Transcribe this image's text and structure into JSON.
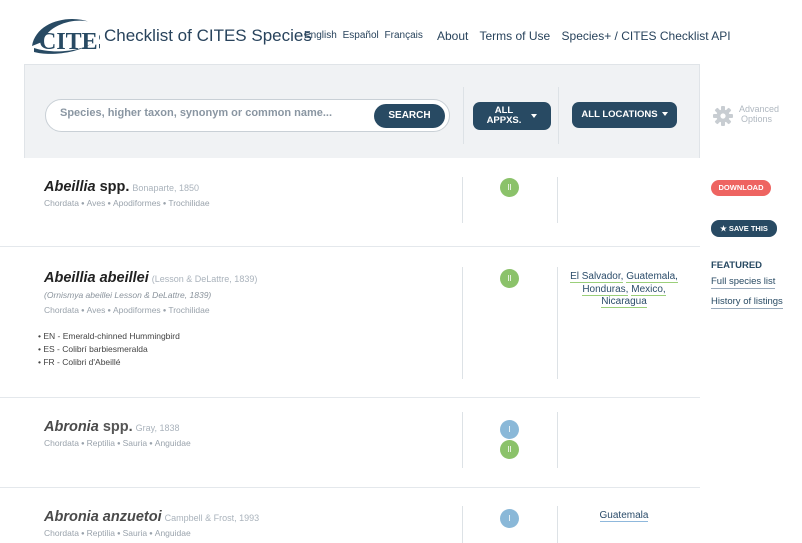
{
  "header": {
    "logo_text": "CITES",
    "title": "Checklist of CITES Species",
    "languages": [
      "English",
      "Español",
      "Français"
    ],
    "nav": [
      "About",
      "Terms of Use",
      "Species+ / CITES Checklist API"
    ]
  },
  "search": {
    "placeholder": "Species, higher taxon, synonym or common name...",
    "button": "SEARCH",
    "appendix_filter_line1": "ALL",
    "appendix_filter_line2": "APPXS.",
    "location_filter": "ALL LOCATIONS",
    "advanced_line1": "Advanced",
    "advanced_line2": "Options"
  },
  "results": [
    {
      "genus_or_name": "Abeillia",
      "suffix": "spp.",
      "author": "Bonaparte, 1850",
      "synonym": "",
      "taxonomy": [
        "Chordata",
        "Aves",
        "Apodiformes",
        "Trochilidae"
      ],
      "common_names": [],
      "appendices": [
        "II"
      ],
      "locations": []
    },
    {
      "genus_or_name": "Abeillia abeillei",
      "suffix": "",
      "author": "(Lesson & DeLattre, 1839)",
      "synonym": "(Ornismya abeillei Lesson & DeLattre, 1839)",
      "taxonomy": [
        "Chordata",
        "Aves",
        "Apodiformes",
        "Trochilidae"
      ],
      "common_names": [
        "• EN - Emerald-chinned Hummingbird",
        "• ES - Colibrí barbiesmeralda",
        "• FR - Colibri d'Abeillé"
      ],
      "appendices": [
        "II"
      ],
      "locations": [
        "El Salvador,",
        "Guatemala,",
        "Honduras,",
        "Mexico,",
        "Nicaragua"
      ]
    },
    {
      "genus_or_name": "Abronia",
      "suffix": "spp.",
      "author": "Gray, 1838",
      "synonym": "",
      "taxonomy": [
        "Chordata",
        "Reptilia",
        "Sauria",
        "Anguidae"
      ],
      "common_names": [],
      "appendices": [
        "I",
        "II"
      ],
      "locations": []
    },
    {
      "genus_or_name": "Abronia anzuetoi",
      "suffix": "",
      "author": "Campbell & Frost, 1993",
      "synonym": "",
      "taxonomy": [
        "Chordata",
        "Reptilia",
        "Sauria",
        "Anguidae"
      ],
      "common_names": [],
      "appendices": [
        "I"
      ],
      "locations": [
        "Guatemala"
      ]
    }
  ],
  "side": {
    "download": "DOWNLOAD",
    "save": "★ SAVE THIS",
    "featured_title": "FEATURED",
    "featured_links": [
      "Full species list",
      "History of listings"
    ]
  },
  "colors": {
    "brand": "#284a63",
    "appendix_i": "#8ab8d8",
    "appendix_ii": "#8bc26a",
    "download": "#ee6461"
  }
}
